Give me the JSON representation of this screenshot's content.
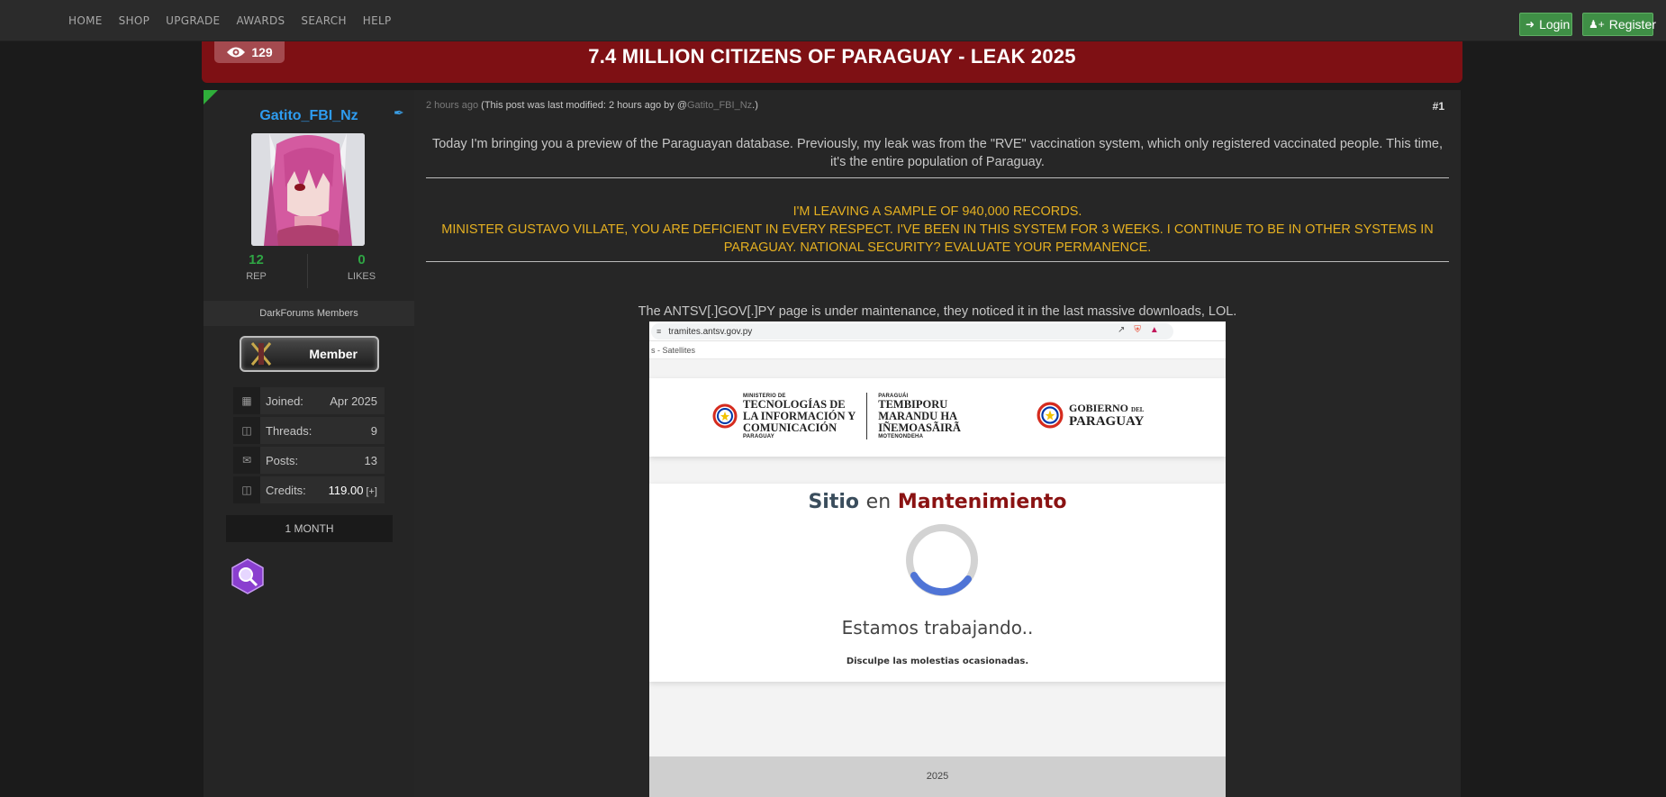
{
  "nav": {
    "links": [
      "HOME",
      "SHOP",
      "UPGRADE",
      "AWARDS",
      "SEARCH",
      "HELP"
    ],
    "login_label": "Login",
    "register_label": "Register"
  },
  "thread": {
    "views": "129",
    "title": "7.4 MILLION CITIZENS OF PARAGUAY - LEAK 2025"
  },
  "profile": {
    "username": "Gatito_FBI_Nz",
    "rep_value": "12",
    "rep_label": "REP",
    "likes_value": "0",
    "likes_label": "LIKES",
    "group": "DarkForums Members",
    "badge_label": "Member",
    "info": [
      {
        "label": "Joined:",
        "value": "Apr 2025",
        "icon": "calendar-icon"
      },
      {
        "label": "Threads:",
        "value": "9",
        "icon": "book-icon"
      },
      {
        "label": "Posts:",
        "value": "13",
        "icon": "comments-icon"
      },
      {
        "label": "Credits:",
        "value": "119.00",
        "extra": "[+]",
        "icon": "coins-icon"
      }
    ],
    "duration": "1 MONTH"
  },
  "post": {
    "time": "2 hours ago",
    "modified_prefix": "(This post was last modified: 2 hours ago by @",
    "modified_user": "Gatito_FBI_Nz",
    "modified_suffix": ".)",
    "number": "#1",
    "intro": "Today I'm bringing you a preview of the Paraguayan database. Previously, my leak was from the \"RVE\" vaccination system, which only registered vaccinated people. This time, it's the entire population of Paraguay.",
    "sample_line": "I'M LEAVING A SAMPLE OF 940,000 RECORDS.",
    "minister_line": "MINISTER GUSTAVO VILLATE, YOU ARE DEFICIENT IN EVERY RESPECT. I'VE BEEN IN THIS SYSTEM FOR 3 WEEKS.  I CONTINUE TO BE IN OTHER SYSTEMS IN PARAGUAY. NATIONAL SECURITY? EVALUATE YOUR PERMANENCE.",
    "maintenance_caption": "The ANTSV[.]GOV[.]PY page is under maintenance, they noticed it in the last massive downloads, LOL."
  },
  "screenshot": {
    "url": "tramites.antsv.gov.py",
    "bookmark": "s - Satellites",
    "mitic_small_top": "MINISTERIO DE",
    "mitic_line1": "TECNOLOGÍAS DE",
    "mitic_line2": "LA INFORMACIÓN Y",
    "mitic_line3": "COMUNICACIÓN",
    "mitic_small_bottom": "PARAGUAY",
    "guarani_small_top": "PARAGUÁI",
    "guarani_line1": "TEMBIPORU",
    "guarani_line2": "MARANDU HA",
    "guarani_line3": "IÑEMOASÃIRÃ",
    "guarani_small_bottom": "MOTENONDEHA",
    "gob_line1": "GOBIERNO",
    "gob_del": "DEL",
    "gob_line2": "PARAGUAY",
    "maint_word1": "Sitio",
    "maint_word2": "en",
    "maint_word3": "Mantenimiento",
    "working": "Estamos trabajando..",
    "apology": "Disculpe las molestias ocasionadas.",
    "footer_year": "2025"
  },
  "colors": {
    "banner": "#7e1014",
    "green_button": "#3f8f46",
    "username": "#2e9cf0",
    "rep": "#2fa544",
    "warning_text": "#e5b021"
  }
}
